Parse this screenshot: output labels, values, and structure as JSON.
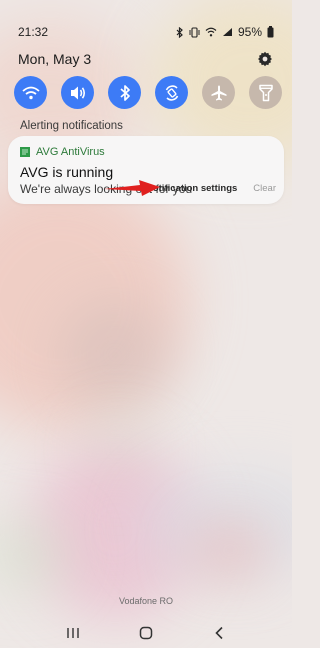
{
  "status_bar": {
    "time": "21:32",
    "battery": "95%",
    "icons": [
      "bluetooth-icon",
      "vibrate-icon",
      "wifi-icon",
      "signal-icon",
      "battery-icon"
    ]
  },
  "header": {
    "date": "Mon, May 3",
    "settings_icon": "gear-icon"
  },
  "quick_settings": [
    {
      "name": "wifi",
      "active": true
    },
    {
      "name": "sound",
      "active": true
    },
    {
      "name": "bluetooth",
      "active": true
    },
    {
      "name": "auto-rotate",
      "active": true
    },
    {
      "name": "airplane-mode",
      "active": false
    },
    {
      "name": "flashlight",
      "active": false
    }
  ],
  "section": {
    "label": "Alerting notifications"
  },
  "notification": {
    "app_name": "AVG AntiVirus",
    "title": "AVG is running",
    "text": "We're always looking out for you"
  },
  "actions": {
    "settings_label": "Notification settings",
    "clear_label": "Clear"
  },
  "carrier": "Vodafone RO",
  "colors": {
    "accent": "#3d7bf6",
    "inactive": "#c6b8ac",
    "arrow": "#e0201f",
    "app_green": "#2d7a3a"
  },
  "nav_bar": [
    "recents-icon",
    "home-icon",
    "back-icon"
  ]
}
